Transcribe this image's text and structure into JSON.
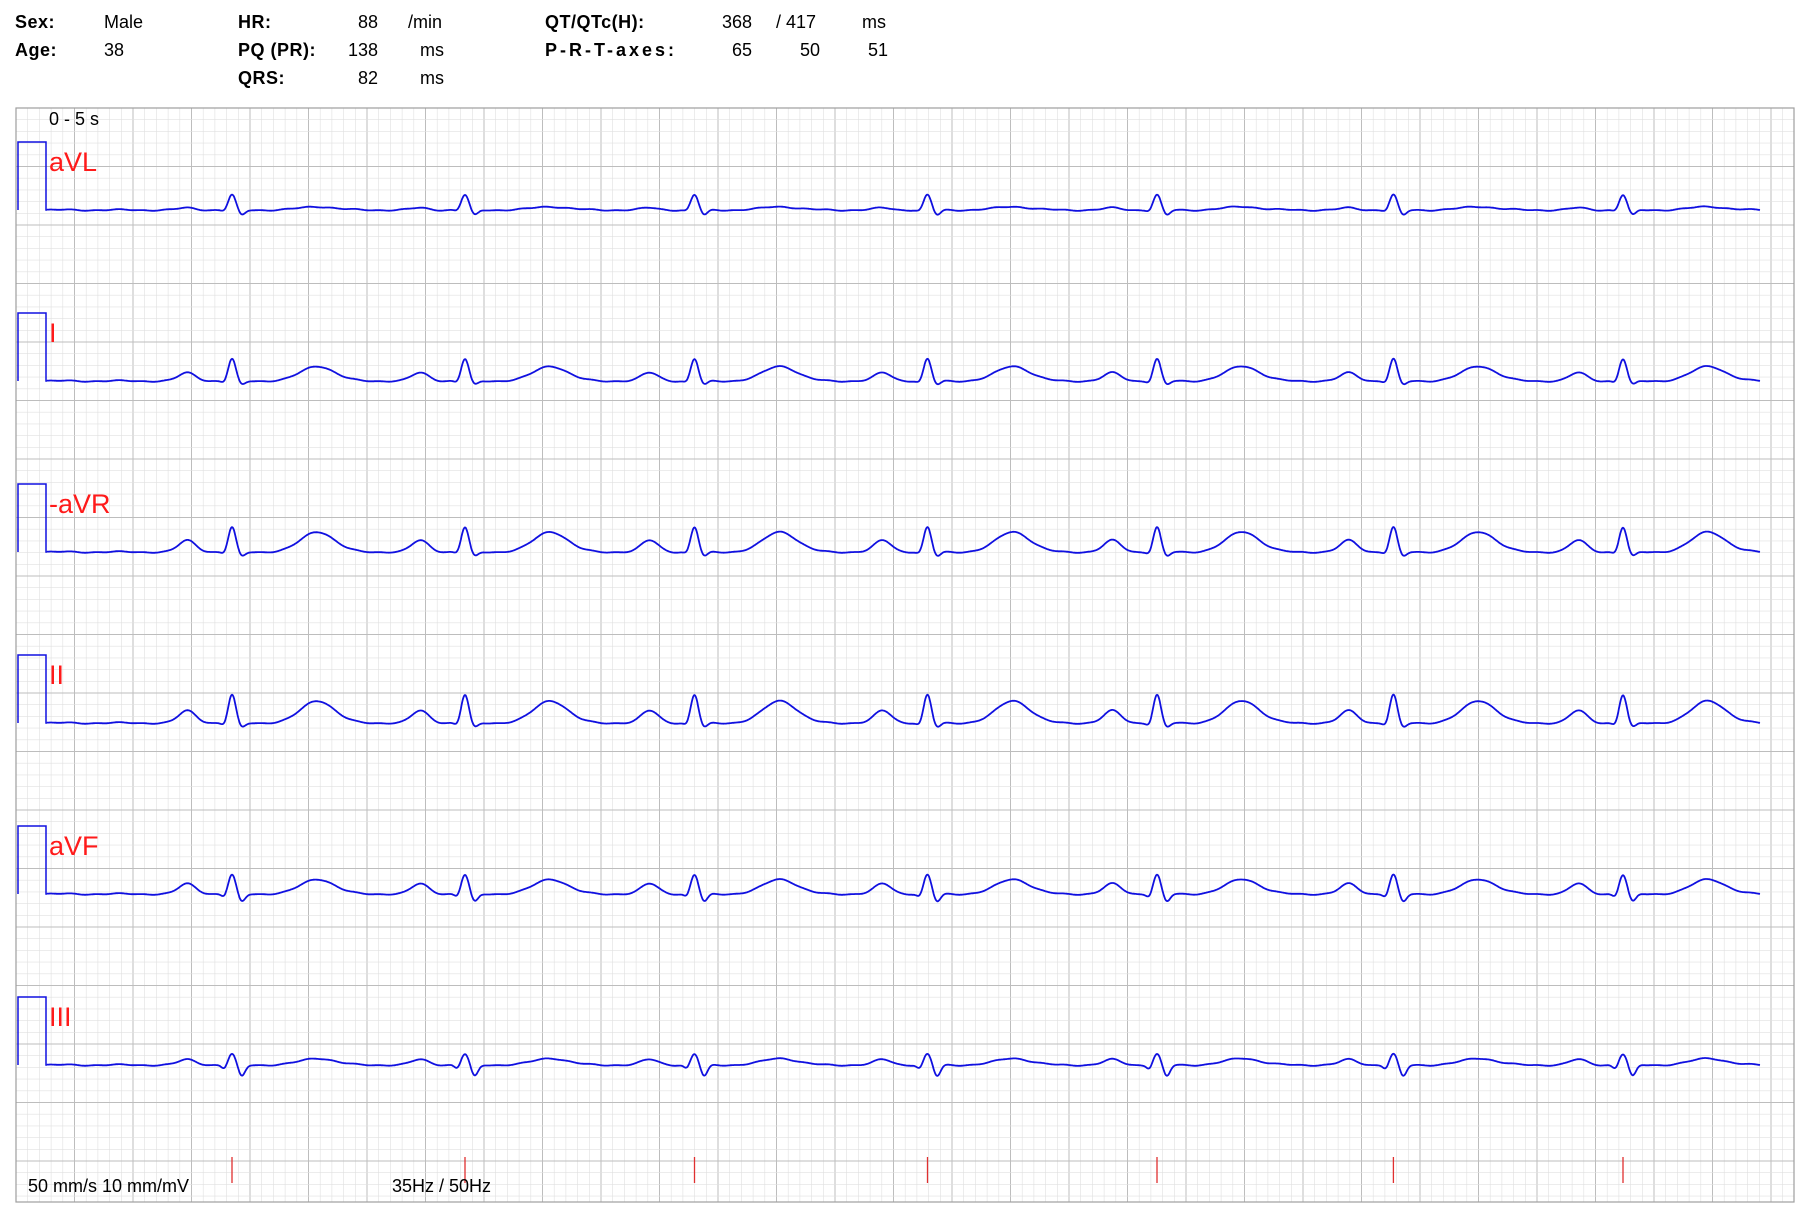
{
  "header": {
    "sex_label": "Sex:",
    "sex": "Male",
    "age_label": "Age:",
    "age": "38",
    "hr_label": "HR:",
    "hr": "88",
    "hr_unit": "/min",
    "pq_label": "PQ (PR):",
    "pq": "138",
    "pq_unit": "ms",
    "qrs_label": "QRS:",
    "qrs": "82",
    "qrs_unit": "ms",
    "qt_label": "QT/QTc(H):",
    "qt": "368",
    "qtc": "/ 417",
    "qt_unit": "ms",
    "axes_label": "P-R-T-axes:",
    "axis_p": "65",
    "axis_r": "50",
    "axis_t": "51"
  },
  "strip": {
    "time_range": "0 - 5 s",
    "paper_speed": "50 mm/s 10 mm/mV",
    "filter": "35Hz / 50Hz"
  },
  "colors": {
    "trace": "#1010e0",
    "lead_label": "#ff1a1a",
    "grid_minor": "#e0e0e0",
    "grid_major": "#bdbdbd",
    "marker": "#e03030"
  },
  "chart_data": {
    "type": "line",
    "title": "",
    "xlabel": "",
    "ylabel": "",
    "xlim": [
      0,
      5
    ],
    "x_unit": "s",
    "leads": [
      {
        "name": "aVL",
        "p": 0.03,
        "q": -0.02,
        "r": 0.22,
        "s": -0.08,
        "t": 0.05
      },
      {
        "name": "I",
        "p": 0.12,
        "q": -0.03,
        "r": 0.32,
        "s": -0.06,
        "t": 0.22
      },
      {
        "name": "-aVR",
        "p": 0.17,
        "q": -0.03,
        "r": 0.36,
        "s": -0.07,
        "t": 0.3
      },
      {
        "name": "II",
        "p": 0.18,
        "q": -0.04,
        "r": 0.41,
        "s": -0.07,
        "t": 0.33
      },
      {
        "name": "aVF",
        "p": 0.15,
        "q": -0.05,
        "r": 0.28,
        "s": -0.12,
        "t": 0.22
      },
      {
        "name": "III",
        "p": 0.08,
        "q": -0.06,
        "r": 0.16,
        "s": -0.17,
        "t": 0.1
      }
    ],
    "beat_times_s": [
      0.54,
      1.22,
      1.89,
      2.57,
      3.24,
      3.93,
      4.6
    ],
    "calibration_mv": 1.0,
    "grid": true
  }
}
